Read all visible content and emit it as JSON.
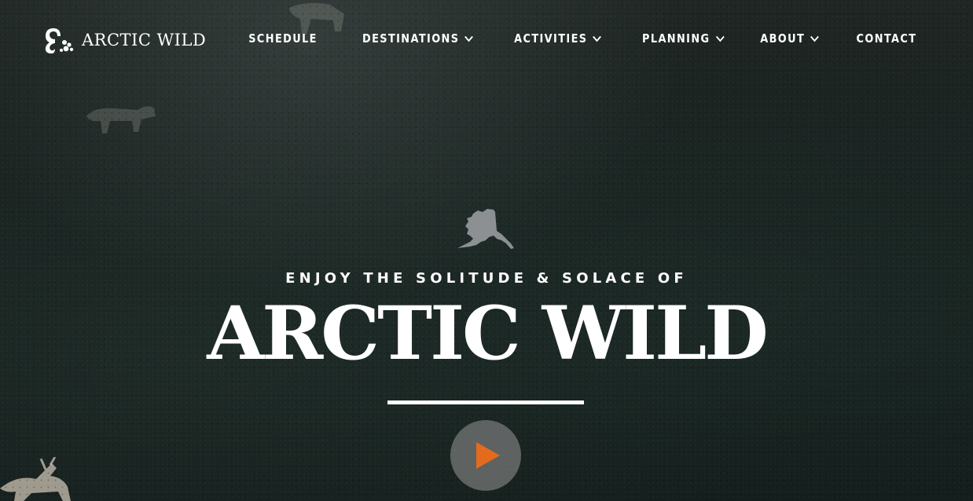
{
  "brand": {
    "name": "ARCTIC WILD",
    "logo_icon": "paw-print-icon"
  },
  "nav": {
    "items": [
      {
        "label": "SCHEDULE",
        "has_dropdown": false
      },
      {
        "label": "DESTINATIONS",
        "has_dropdown": true
      },
      {
        "label": "ACTIVITIES",
        "has_dropdown": true
      },
      {
        "label": "PLANNING",
        "has_dropdown": true
      },
      {
        "label": "ABOUT",
        "has_dropdown": true
      },
      {
        "label": "CONTACT",
        "has_dropdown": false
      }
    ],
    "dropdown_icon": "chevron-down-icon"
  },
  "hero": {
    "map_icon": "alaska-map-icon",
    "tagline": "ENJOY THE SOLITUDE & SOLACE OF",
    "title": "ARCTIC WILD",
    "play_icon": "play-icon"
  },
  "colors": {
    "accent": "#e46b1e",
    "map_gray": "#8c9092",
    "text": "#ffffff",
    "background": "#16211f"
  }
}
